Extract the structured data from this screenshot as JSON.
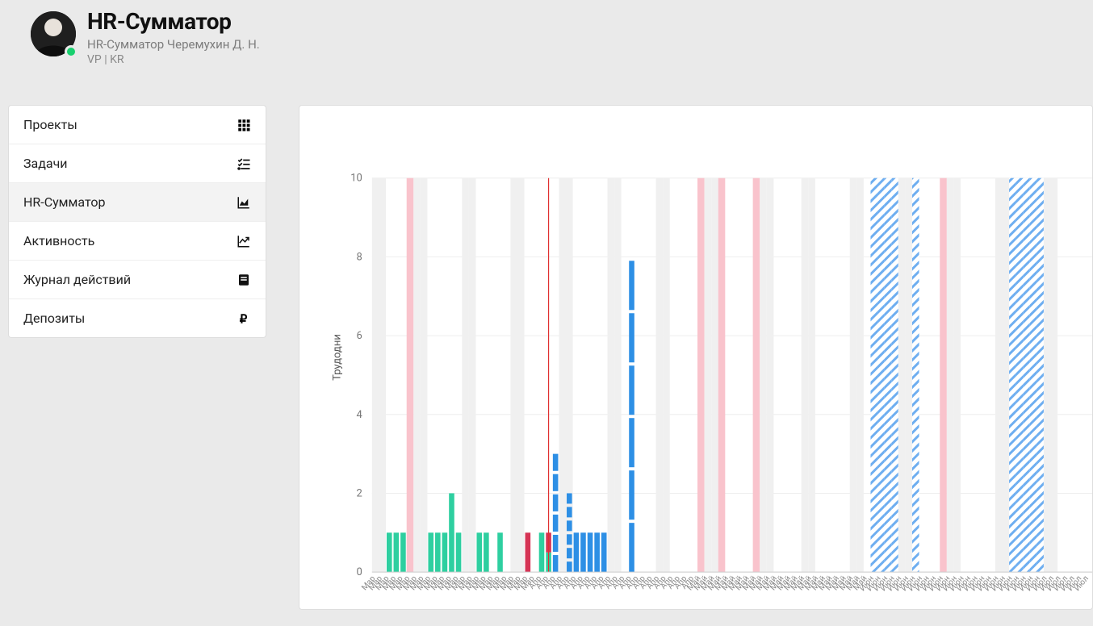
{
  "header": {
    "title": "HR-Сумматор",
    "subtitle1": "HR-Сумматор Черемухин Д. Н.",
    "subtitle2": "VP | KR"
  },
  "sidebar": {
    "items": [
      {
        "label": "Проекты",
        "icon": "grid-icon",
        "active": false
      },
      {
        "label": "Задачи",
        "icon": "tasks-icon",
        "active": false
      },
      {
        "label": "HR-Сумматор",
        "icon": "area-icon",
        "active": true
      },
      {
        "label": "Активность",
        "icon": "trend-icon",
        "active": false
      },
      {
        "label": "Журнал действий",
        "icon": "journal-icon",
        "active": false
      },
      {
        "label": "Депозиты",
        "icon": "ruble-icon",
        "active": false
      }
    ]
  },
  "chart_data": {
    "type": "bar",
    "ylabel": "Трудодни",
    "ylim": [
      0,
      10
    ],
    "yticks": [
      0,
      2,
      4,
      6,
      8,
      10
    ],
    "months": [
      "Мар",
      "Апр",
      "Май",
      "Июн",
      "Июл"
    ],
    "today_index": 25,
    "days": [
      {
        "idx": 0,
        "m": "Мар",
        "weekend": true
      },
      {
        "idx": 1,
        "m": "Мар",
        "weekend": true
      },
      {
        "idx": 2,
        "m": "Мар",
        "green": 1
      },
      {
        "idx": 3,
        "m": "Мар",
        "green": 1
      },
      {
        "idx": 4,
        "m": "Мар",
        "green": 1
      },
      {
        "idx": 5,
        "m": "Мар",
        "holiday": true
      },
      {
        "idx": 6,
        "m": "Мар",
        "weekend": true
      },
      {
        "idx": 7,
        "m": "Мар",
        "weekend": true
      },
      {
        "idx": 8,
        "m": "Мар",
        "green": 1
      },
      {
        "idx": 9,
        "m": "Мар",
        "green": 1
      },
      {
        "idx": 10,
        "m": "Мар",
        "green": 1
      },
      {
        "idx": 11,
        "m": "Мар",
        "green": 2
      },
      {
        "idx": 12,
        "m": "Мар",
        "green": 1
      },
      {
        "idx": 13,
        "m": "Мар",
        "weekend": true
      },
      {
        "idx": 14,
        "m": "Мар",
        "weekend": true
      },
      {
        "idx": 15,
        "m": "Мар",
        "green": 1
      },
      {
        "idx": 16,
        "m": "Мар",
        "green": 1
      },
      {
        "idx": 17,
        "m": "Мар"
      },
      {
        "idx": 18,
        "m": "Мар",
        "green": 1
      },
      {
        "idx": 19,
        "m": "Мар"
      },
      {
        "idx": 20,
        "m": "Мар",
        "weekend": true
      },
      {
        "idx": 21,
        "m": "Мар",
        "weekend": true
      },
      {
        "idx": 22,
        "m": "Мар",
        "red": 1
      },
      {
        "idx": 23,
        "m": "Мар"
      },
      {
        "idx": 24,
        "m": "Апр",
        "green": 1
      },
      {
        "idx": 25,
        "m": "Апр",
        "green": 0.5,
        "red": 0.5
      },
      {
        "idx": 26,
        "m": "Апр",
        "blue": 3,
        "dashed": true
      },
      {
        "idx": 27,
        "m": "Апр",
        "weekend": true
      },
      {
        "idx": 28,
        "m": "Апр",
        "weekend": true,
        "blue": 2,
        "dashed": true
      },
      {
        "idx": 29,
        "m": "Апр",
        "blue": 1
      },
      {
        "idx": 30,
        "m": "Апр",
        "blue": 1
      },
      {
        "idx": 31,
        "m": "Апр",
        "blue": 1
      },
      {
        "idx": 32,
        "m": "Апр",
        "blue": 1
      },
      {
        "idx": 33,
        "m": "Апр",
        "blue": 1
      },
      {
        "idx": 34,
        "m": "Апр",
        "weekend": true
      },
      {
        "idx": 35,
        "m": "Апр",
        "weekend": true
      },
      {
        "idx": 36,
        "m": "Апр"
      },
      {
        "idx": 37,
        "m": "Апр",
        "blue": 7.9,
        "dashed": true
      },
      {
        "idx": 38,
        "m": "Апр"
      },
      {
        "idx": 39,
        "m": "Апр"
      },
      {
        "idx": 40,
        "m": "Апр"
      },
      {
        "idx": 41,
        "m": "Апр",
        "weekend": true
      },
      {
        "idx": 42,
        "m": "Апр",
        "weekend": true
      },
      {
        "idx": 43,
        "m": "Апр"
      },
      {
        "idx": 44,
        "m": "Апр"
      },
      {
        "idx": 45,
        "m": "Апр"
      },
      {
        "idx": 46,
        "m": "Апр"
      },
      {
        "idx": 47,
        "m": "Май",
        "holiday": true
      },
      {
        "idx": 48,
        "m": "Май",
        "weekend": true
      },
      {
        "idx": 49,
        "m": "Май",
        "weekend": true
      },
      {
        "idx": 50,
        "m": "Май",
        "holiday": true
      },
      {
        "idx": 51,
        "m": "Май"
      },
      {
        "idx": 52,
        "m": "Май"
      },
      {
        "idx": 53,
        "m": "Май"
      },
      {
        "idx": 54,
        "m": "Май"
      },
      {
        "idx": 55,
        "m": "Май",
        "holiday": true
      },
      {
        "idx": 56,
        "m": "Май",
        "weekend": true
      },
      {
        "idx": 57,
        "m": "Май",
        "weekend": true
      },
      {
        "idx": 58,
        "m": "Май"
      },
      {
        "idx": 59,
        "m": "Май"
      },
      {
        "idx": 60,
        "m": "Май"
      },
      {
        "idx": 61,
        "m": "Май"
      },
      {
        "idx": 62,
        "m": "Май",
        "weekend": true
      },
      {
        "idx": 63,
        "m": "Май",
        "weekend": true
      },
      {
        "idx": 64,
        "m": "Май"
      },
      {
        "idx": 65,
        "m": "Май"
      },
      {
        "idx": 66,
        "m": "Май"
      },
      {
        "idx": 67,
        "m": "Май"
      },
      {
        "idx": 68,
        "m": "Май"
      },
      {
        "idx": 69,
        "m": "Май",
        "weekend": true
      },
      {
        "idx": 70,
        "m": "Май",
        "weekend": true
      },
      {
        "idx": 71,
        "m": "Май"
      },
      {
        "idx": 72,
        "m": "Июн",
        "vacation": true
      },
      {
        "idx": 73,
        "m": "Июн",
        "vacation": true
      },
      {
        "idx": 74,
        "m": "Июн",
        "vacation": true
      },
      {
        "idx": 75,
        "m": "Июн",
        "vacation": true
      },
      {
        "idx": 76,
        "m": "Июн",
        "weekend": true
      },
      {
        "idx": 77,
        "m": "Июн",
        "weekend": true
      },
      {
        "idx": 78,
        "m": "Июн",
        "vacation": true
      },
      {
        "idx": 79,
        "m": "Июн"
      },
      {
        "idx": 80,
        "m": "Июн"
      },
      {
        "idx": 81,
        "m": "Июн"
      },
      {
        "idx": 82,
        "m": "Июн",
        "holiday": true
      },
      {
        "idx": 83,
        "m": "Июн",
        "weekend": true
      },
      {
        "idx": 84,
        "m": "Июн",
        "weekend": true
      },
      {
        "idx": 85,
        "m": "Июн"
      },
      {
        "idx": 86,
        "m": "Июн"
      },
      {
        "idx": 87,
        "m": "Июн"
      },
      {
        "idx": 88,
        "m": "Июн"
      },
      {
        "idx": 89,
        "m": "Июн"
      },
      {
        "idx": 90,
        "m": "Июн",
        "weekend": true
      },
      {
        "idx": 91,
        "m": "Июн",
        "weekend": true
      },
      {
        "idx": 92,
        "m": "Июн",
        "vacation": true
      },
      {
        "idx": 93,
        "m": "Июн",
        "vacation": true
      },
      {
        "idx": 94,
        "m": "Июн",
        "vacation": true
      },
      {
        "idx": 95,
        "m": "Июн",
        "vacation": true
      },
      {
        "idx": 96,
        "m": "Июн",
        "vacation": true
      },
      {
        "idx": 97,
        "m": "Июл",
        "weekend": true
      },
      {
        "idx": 98,
        "m": "Июл",
        "weekend": true
      },
      {
        "idx": 99,
        "m": "Июл"
      },
      {
        "idx": 100,
        "m": "Июл"
      },
      {
        "idx": 101,
        "m": "Июл"
      },
      {
        "idx": 102,
        "m": "Июл"
      },
      {
        "idx": 103,
        "m": "Июл"
      }
    ]
  },
  "colors": {
    "green": "#2ecfa0",
    "blue": "#2d8fe5",
    "red": "#d63455",
    "weekend": "#f0f0f0",
    "holiday": "#f9c3cc",
    "vacation_stroke": "#6eaef0",
    "today": "#e03030",
    "axis": "#888",
    "grid": "#eee"
  }
}
